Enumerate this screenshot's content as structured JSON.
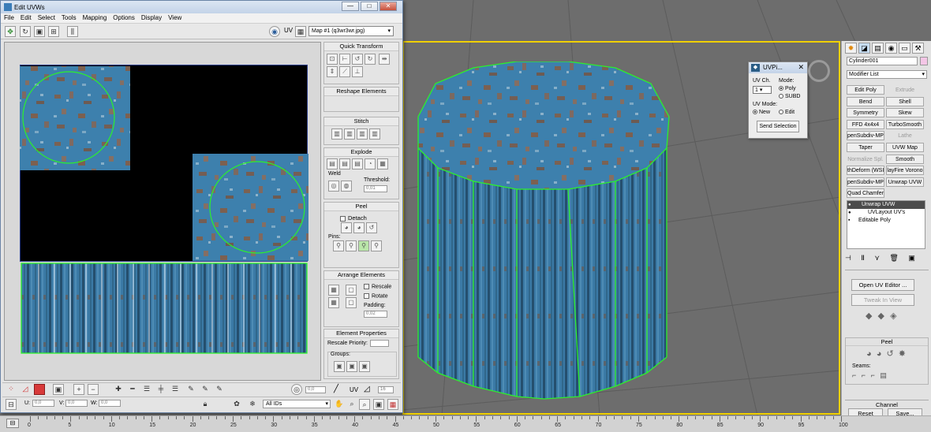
{
  "edit_uvws": {
    "title": "Edit UVWs",
    "window_buttons": [
      "—",
      "□",
      "✕"
    ],
    "menu": [
      "File",
      "Edit",
      "Select",
      "Tools",
      "Mapping",
      "Options",
      "Display",
      "View"
    ],
    "toolbar": {
      "uv_label": "UV",
      "map_select": "Map #1 (q3wr3wr.jpg)"
    },
    "side_panel": {
      "quick_transform": "Quick Transform",
      "reshape_elements": "Reshape Elements",
      "stitch": "Stitch",
      "explode": "Explode",
      "weld": "Weld",
      "threshold_label": "Threshold:",
      "threshold_value": "0,01",
      "peel": "Peel",
      "detach_label": "Detach",
      "pins_label": "Pins:",
      "arrange_elements": "Arrange Elements",
      "rescale_label": "Rescale",
      "rotate_label": "Rotate",
      "padding_label": "Padding:",
      "padding_value": "0,02",
      "element_properties": "Element Properties",
      "rescale_priority_label": "Rescale Priority:",
      "groups_label": "Groups:"
    },
    "bottom": {
      "spin_value": "0,0",
      "uv_label": "UV",
      "degree_value": "16",
      "u_label": "U:",
      "u_value": "0,0",
      "v_label": "V:",
      "v_value": "0,0",
      "w_label": "W:",
      "w_value": "0,0",
      "ids_select": "All IDs"
    }
  },
  "uvpicker": {
    "title": "UVPi...",
    "uv_ch_label": "UV Ch.",
    "uv_ch_value": "1",
    "mode_label": "Mode:",
    "mode_poly": "Poly",
    "mode_subd": "SUBD",
    "uv_mode_label": "UV Mode:",
    "uv_mode_new": "New",
    "uv_mode_edit": "Edit",
    "send_button": "Send Selection"
  },
  "command_panel": {
    "object_name": "Cylinder001",
    "modifier_list": "Modifier List",
    "modifier_buttons": [
      [
        "Edit Poly",
        "Extrude"
      ],
      [
        "Bend",
        "Shell"
      ],
      [
        "Symmetry",
        "Skew"
      ],
      [
        "FFD 4x4x4",
        "TurboSmooth"
      ],
      [
        "penSubdiv-MP",
        "Lathe"
      ],
      [
        "Taper",
        "UVW Map"
      ],
      [
        "Normalize Spl.",
        "Smooth"
      ],
      [
        "thDeform (WSI",
        "layFire Vorono"
      ],
      [
        "penSubdiv-MP",
        "Unwrap UVW"
      ],
      [
        "Quad Chamfer",
        ""
      ]
    ],
    "stack": [
      "Unwrap UVW",
      "UVLayout UV's",
      "Editable Poly"
    ],
    "open_uv_editor": "Open UV Editor ...",
    "tweak_in_view": "Tweak In View",
    "peel": "Peel",
    "seams_label": "Seams:",
    "channel": "Channel",
    "reset_uvws": "Reset UVWs",
    "save": "Save..."
  },
  "timeline": {
    "labels": [
      "0",
      "5",
      "10",
      "15",
      "20",
      "25",
      "30",
      "35",
      "40",
      "45",
      "50",
      "55",
      "60",
      "65",
      "70",
      "75",
      "80",
      "85",
      "90",
      "95",
      "100"
    ]
  },
  "colors": {
    "selection_edge": "#2cf02c",
    "viewport_frame": "#f0d000",
    "rust_blue": "#3b7fae",
    "rust_orange": "#a0522d"
  }
}
